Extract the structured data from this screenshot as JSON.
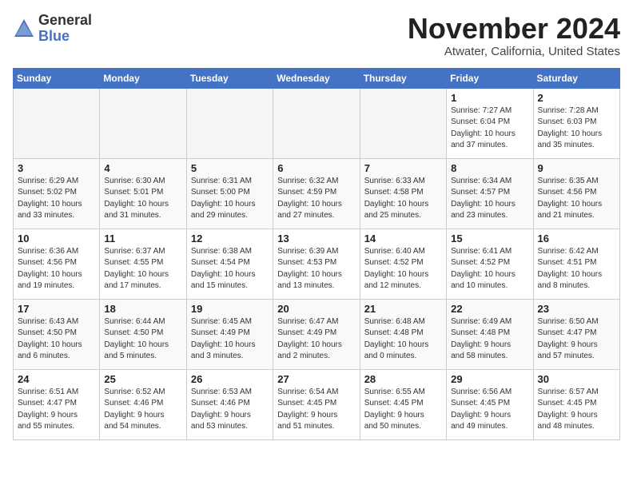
{
  "logo": {
    "general": "General",
    "blue": "Blue"
  },
  "title": "November 2024",
  "location": "Atwater, California, United States",
  "days_header": [
    "Sunday",
    "Monday",
    "Tuesday",
    "Wednesday",
    "Thursday",
    "Friday",
    "Saturday"
  ],
  "weeks": [
    [
      {
        "day": "",
        "info": ""
      },
      {
        "day": "",
        "info": ""
      },
      {
        "day": "",
        "info": ""
      },
      {
        "day": "",
        "info": ""
      },
      {
        "day": "",
        "info": ""
      },
      {
        "day": "1",
        "info": "Sunrise: 7:27 AM\nSunset: 6:04 PM\nDaylight: 10 hours\nand 37 minutes."
      },
      {
        "day": "2",
        "info": "Sunrise: 7:28 AM\nSunset: 6:03 PM\nDaylight: 10 hours\nand 35 minutes."
      }
    ],
    [
      {
        "day": "3",
        "info": "Sunrise: 6:29 AM\nSunset: 5:02 PM\nDaylight: 10 hours\nand 33 minutes."
      },
      {
        "day": "4",
        "info": "Sunrise: 6:30 AM\nSunset: 5:01 PM\nDaylight: 10 hours\nand 31 minutes."
      },
      {
        "day": "5",
        "info": "Sunrise: 6:31 AM\nSunset: 5:00 PM\nDaylight: 10 hours\nand 29 minutes."
      },
      {
        "day": "6",
        "info": "Sunrise: 6:32 AM\nSunset: 4:59 PM\nDaylight: 10 hours\nand 27 minutes."
      },
      {
        "day": "7",
        "info": "Sunrise: 6:33 AM\nSunset: 4:58 PM\nDaylight: 10 hours\nand 25 minutes."
      },
      {
        "day": "8",
        "info": "Sunrise: 6:34 AM\nSunset: 4:57 PM\nDaylight: 10 hours\nand 23 minutes."
      },
      {
        "day": "9",
        "info": "Sunrise: 6:35 AM\nSunset: 4:56 PM\nDaylight: 10 hours\nand 21 minutes."
      }
    ],
    [
      {
        "day": "10",
        "info": "Sunrise: 6:36 AM\nSunset: 4:56 PM\nDaylight: 10 hours\nand 19 minutes."
      },
      {
        "day": "11",
        "info": "Sunrise: 6:37 AM\nSunset: 4:55 PM\nDaylight: 10 hours\nand 17 minutes."
      },
      {
        "day": "12",
        "info": "Sunrise: 6:38 AM\nSunset: 4:54 PM\nDaylight: 10 hours\nand 15 minutes."
      },
      {
        "day": "13",
        "info": "Sunrise: 6:39 AM\nSunset: 4:53 PM\nDaylight: 10 hours\nand 13 minutes."
      },
      {
        "day": "14",
        "info": "Sunrise: 6:40 AM\nSunset: 4:52 PM\nDaylight: 10 hours\nand 12 minutes."
      },
      {
        "day": "15",
        "info": "Sunrise: 6:41 AM\nSunset: 4:52 PM\nDaylight: 10 hours\nand 10 minutes."
      },
      {
        "day": "16",
        "info": "Sunrise: 6:42 AM\nSunset: 4:51 PM\nDaylight: 10 hours\nand 8 minutes."
      }
    ],
    [
      {
        "day": "17",
        "info": "Sunrise: 6:43 AM\nSunset: 4:50 PM\nDaylight: 10 hours\nand 6 minutes."
      },
      {
        "day": "18",
        "info": "Sunrise: 6:44 AM\nSunset: 4:50 PM\nDaylight: 10 hours\nand 5 minutes."
      },
      {
        "day": "19",
        "info": "Sunrise: 6:45 AM\nSunset: 4:49 PM\nDaylight: 10 hours\nand 3 minutes."
      },
      {
        "day": "20",
        "info": "Sunrise: 6:47 AM\nSunset: 4:49 PM\nDaylight: 10 hours\nand 2 minutes."
      },
      {
        "day": "21",
        "info": "Sunrise: 6:48 AM\nSunset: 4:48 PM\nDaylight: 10 hours\nand 0 minutes."
      },
      {
        "day": "22",
        "info": "Sunrise: 6:49 AM\nSunset: 4:48 PM\nDaylight: 9 hours\nand 58 minutes."
      },
      {
        "day": "23",
        "info": "Sunrise: 6:50 AM\nSunset: 4:47 PM\nDaylight: 9 hours\nand 57 minutes."
      }
    ],
    [
      {
        "day": "24",
        "info": "Sunrise: 6:51 AM\nSunset: 4:47 PM\nDaylight: 9 hours\nand 55 minutes."
      },
      {
        "day": "25",
        "info": "Sunrise: 6:52 AM\nSunset: 4:46 PM\nDaylight: 9 hours\nand 54 minutes."
      },
      {
        "day": "26",
        "info": "Sunrise: 6:53 AM\nSunset: 4:46 PM\nDaylight: 9 hours\nand 53 minutes."
      },
      {
        "day": "27",
        "info": "Sunrise: 6:54 AM\nSunset: 4:45 PM\nDaylight: 9 hours\nand 51 minutes."
      },
      {
        "day": "28",
        "info": "Sunrise: 6:55 AM\nSunset: 4:45 PM\nDaylight: 9 hours\nand 50 minutes."
      },
      {
        "day": "29",
        "info": "Sunrise: 6:56 AM\nSunset: 4:45 PM\nDaylight: 9 hours\nand 49 minutes."
      },
      {
        "day": "30",
        "info": "Sunrise: 6:57 AM\nSunset: 4:45 PM\nDaylight: 9 hours\nand 48 minutes."
      }
    ]
  ]
}
